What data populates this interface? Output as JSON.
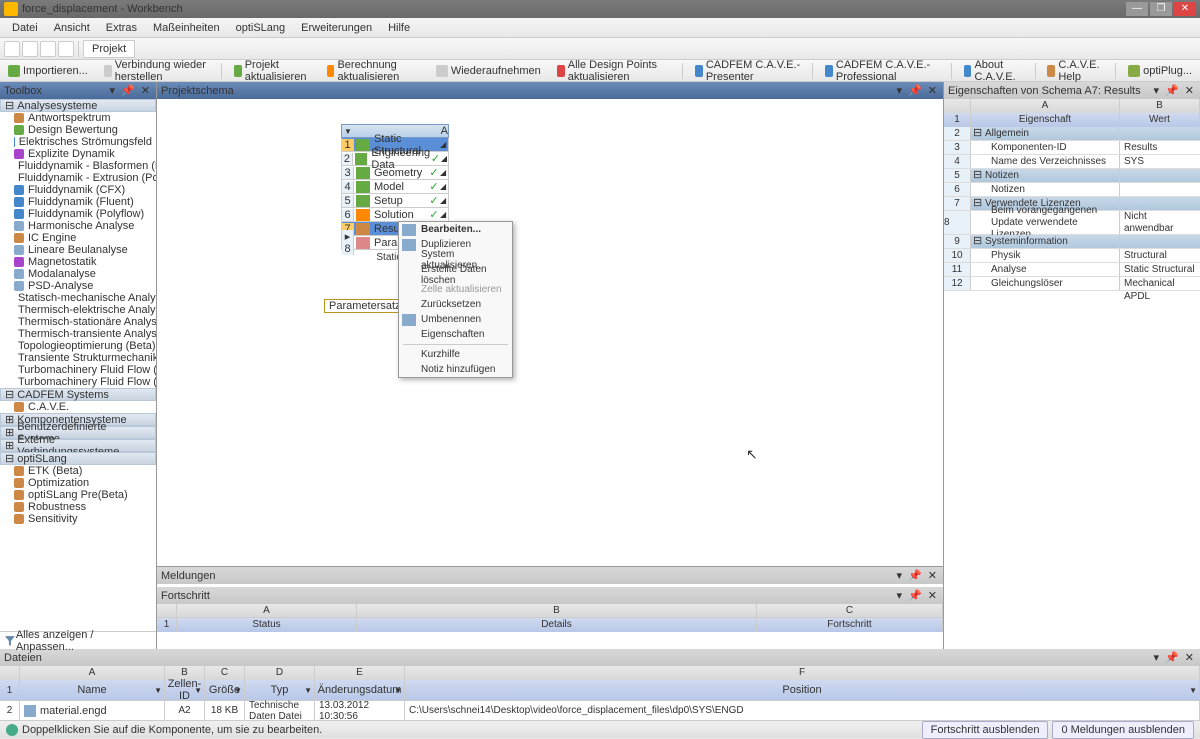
{
  "title": "force_displacement - Workbench",
  "menu": [
    "Datei",
    "Ansicht",
    "Extras",
    "Maßeinheiten",
    "optiSLang",
    "Erweiterungen",
    "Hilfe"
  ],
  "toolbar": {
    "projekt": "Projekt"
  },
  "toolbar2": {
    "import": "Importieren...",
    "reconnect": "Verbindung wieder herstellen",
    "proj_update": "Projekt aktualisieren",
    "calc_update": "Berechnung aktualisieren",
    "resume": "Wiederaufnehmen",
    "dp": "Alle Design Points aktualisieren",
    "presenter": "CADFEM C.A.V.E.-Presenter",
    "prof": "CADFEM C.A.V.E.-Professional",
    "about": "About C.A.V.E.",
    "help": "C.A.V.E. Help",
    "plug": "optiPlug..."
  },
  "toolbox": {
    "title": "Toolbox",
    "cat1": "Analysesysteme",
    "items1": [
      "Antwortspektrum",
      "Design Bewertung",
      "Elektrisches Strömungsfeld",
      "Explizite Dynamik",
      "Fluiddynamik - Blasformen (Polyflow)",
      "Fluiddynamik - Extrusion (Polyflow)",
      "Fluiddynamik (CFX)",
      "Fluiddynamik (Fluent)",
      "Fluiddynamik (Polyflow)",
      "Harmonische Analyse",
      "IC Engine",
      "Lineare Beulanalyse",
      "Magnetostatik",
      "Modalanalyse",
      "PSD-Analyse",
      "Statisch-mechanische Analyse",
      "Thermisch-elektrische Analyse",
      "Thermisch-stationäre Analyse",
      "Thermisch-transiente Analyse",
      "Topologieoptimierung (Beta)",
      "Transiente Strukturmechanik",
      "Turbomachinery Fluid Flow (BladeEditor) (",
      "Turbomachinery Fluid Flow (BladeGen) (Be"
    ],
    "cat2": "CADFEM Systems",
    "items2": [
      "C.A.V.E."
    ],
    "cat3": "Komponentensysteme",
    "cat4": "Benutzerdefinierte Systeme",
    "cat5": "Externe Verbindungssysteme",
    "cat6": "optiSLang",
    "items6": [
      "ETK (Beta)",
      "Optimization",
      "optiSLang Pre(Beta)",
      "Robustness",
      "Sensitivity"
    ],
    "footer": "Alles anzeigen / Anpassen..."
  },
  "schema": {
    "title": "Projektschema",
    "col": "A",
    "rows": [
      {
        "n": "1",
        "label": "Static Structural",
        "sel": true
      },
      {
        "n": "2",
        "label": "Engineering Data",
        "chk": "✓"
      },
      {
        "n": "3",
        "label": "Geometry",
        "chk": "✓"
      },
      {
        "n": "4",
        "label": "Model",
        "chk": "✓"
      },
      {
        "n": "5",
        "label": "Setup",
        "chk": "✓"
      },
      {
        "n": "6",
        "label": "Solution",
        "chk": "✓"
      },
      {
        "n": "7",
        "label": "Results",
        "psel": true
      },
      {
        "n": "8",
        "label": "Paramete",
        "arrow": true
      }
    ],
    "caption": "Static St",
    "paramsatz": "Parametersatz"
  },
  "context": [
    {
      "label": "Bearbeiten...",
      "bold": true,
      "icon": true
    },
    {
      "label": "Duplizieren",
      "icon": true
    },
    {
      "label": "System aktualisieren"
    },
    {
      "label": "Erstellte Daten löschen"
    },
    {
      "label": "Zelle aktualisieren",
      "dis": true
    },
    {
      "label": "Zurücksetzen"
    },
    {
      "label": "Umbenennen",
      "icon": true
    },
    {
      "label": "Eigenschaften"
    },
    {
      "sep": true
    },
    {
      "label": "Kurzhilfe"
    },
    {
      "label": "Notiz hinzufügen"
    }
  ],
  "msg": {
    "title": "Meldungen"
  },
  "fort": {
    "title": "Fortschritt",
    "cols": [
      "A",
      "B",
      "C"
    ],
    "hdrs": [
      "Status",
      "Details",
      "Fortschritt"
    ]
  },
  "files": {
    "title": "Dateien",
    "cols": [
      "A",
      "B",
      "C",
      "D",
      "E",
      "F"
    ],
    "hdrs": [
      "Name",
      "Zellen-ID",
      "Größe",
      "Typ",
      "Änderungsdatum",
      "Position"
    ],
    "row": {
      "n": "2",
      "name": "material.engd",
      "cell": "A2",
      "size": "18 KB",
      "type": "Technische Daten Datei",
      "date": "13.03.2012 10:30:56",
      "pos": "C:\\Users\\schnei14\\Desktop\\video\\force_displacement_files\\dp0\\SYS\\ENGD"
    }
  },
  "props": {
    "title": "Eigenschaften von Schema A7: Results",
    "cols": [
      "A",
      "B"
    ],
    "hdrs": [
      "Eigenschaft",
      "Wert"
    ],
    "rows": [
      {
        "n": "2",
        "grp": true,
        "k": "Allgemein"
      },
      {
        "n": "3",
        "k": "Komponenten-ID",
        "v": "Results"
      },
      {
        "n": "4",
        "k": "Name des Verzeichnisses",
        "v": "SYS"
      },
      {
        "n": "5",
        "grp": true,
        "k": "Notizen"
      },
      {
        "n": "6",
        "k": "Notizen",
        "v": ""
      },
      {
        "n": "7",
        "grp": true,
        "k": "Verwendete Lizenzen"
      },
      {
        "n": "8",
        "k": "Beim vorangegangenen Update verwendete Lizenzen",
        "v": "Nicht anwendbar",
        "tall": true
      },
      {
        "n": "9",
        "grp": true,
        "k": "Systeminformation"
      },
      {
        "n": "10",
        "k": "Physik",
        "v": "Structural"
      },
      {
        "n": "11",
        "k": "Analyse",
        "v": "Static Structural"
      },
      {
        "n": "12",
        "k": "Gleichungslöser",
        "v": "Mechanical APDL"
      }
    ]
  },
  "status": {
    "text": "Doppelklicken Sie auf die Komponente, um sie zu bearbeiten.",
    "b1": "Fortschritt ausblenden",
    "b2": "0 Meldungen ausblenden"
  }
}
